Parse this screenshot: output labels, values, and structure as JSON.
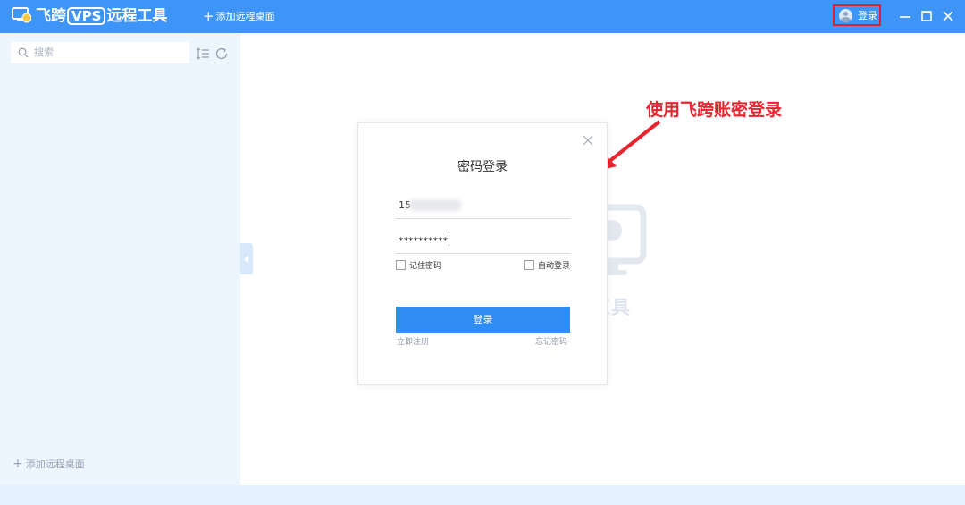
{
  "titlebar": {
    "app_title_prefix": "飞跨",
    "app_title_vps": "VPS",
    "app_title_suffix": "远程工具",
    "add_remote_label": "添加远程桌面",
    "login_label": "登录",
    "accent_color": "#3e95f7",
    "highlight_color": "#e0202c"
  },
  "sidebar": {
    "search_placeholder": "搜索",
    "add_remote_label": "添加远程桌面",
    "background_color": "#edf5ff"
  },
  "background": {
    "app_text": "程工具"
  },
  "annotation": {
    "text": "使用飞跨账密登录",
    "color": "#e8252f"
  },
  "login_dialog": {
    "title": "密码登录",
    "username_visible": "15",
    "password_masked": "**********",
    "remember_password_label": "记住密码",
    "auto_login_label": "自动登录",
    "login_button_label": "登录",
    "register_link": "立即注册",
    "forgot_link": "忘记密码",
    "button_color": "#2e8cf2"
  }
}
